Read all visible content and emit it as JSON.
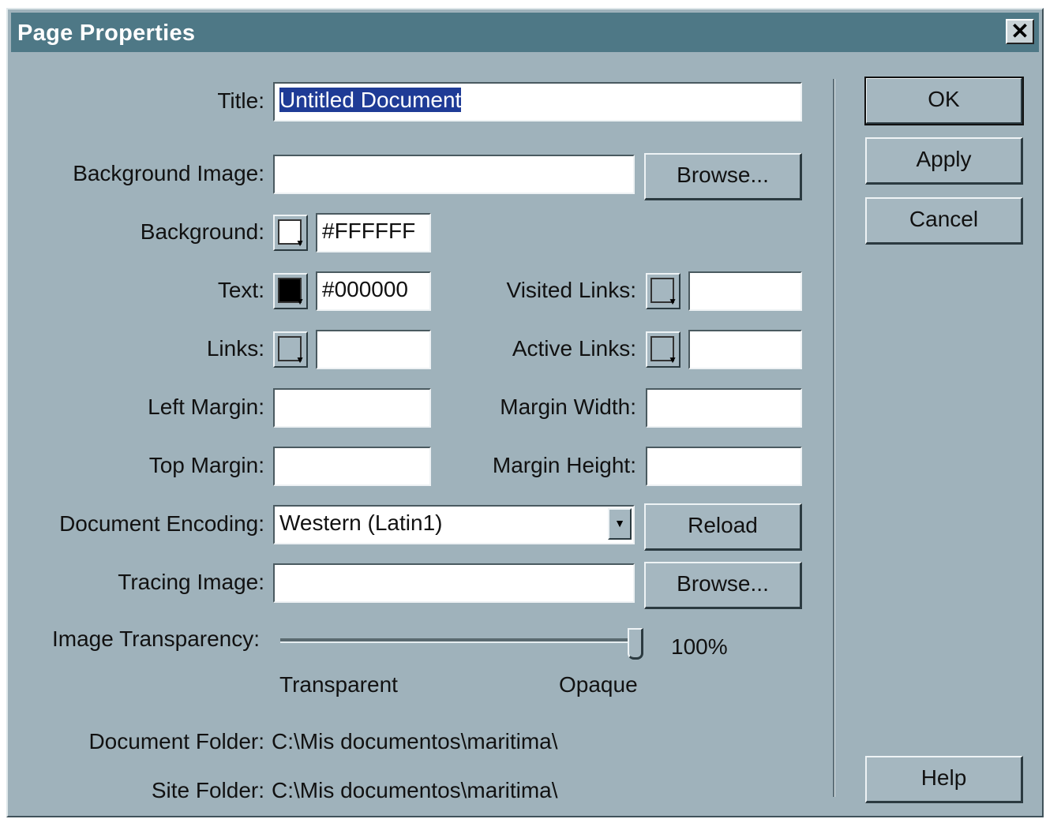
{
  "window": {
    "title": "Page Properties",
    "close_glyph": "✕"
  },
  "buttons": {
    "ok": "OK",
    "apply": "Apply",
    "cancel": "Cancel",
    "help": "Help",
    "browse_bg": "Browse...",
    "reload": "Reload",
    "browse_tracing": "Browse..."
  },
  "labels": {
    "title": "Title:",
    "background_image": "Background Image:",
    "background": "Background:",
    "text": "Text:",
    "links": "Links:",
    "visited_links": "Visited Links:",
    "active_links": "Active Links:",
    "left_margin": "Left Margin:",
    "margin_width": "Margin Width:",
    "top_margin": "Top Margin:",
    "margin_height": "Margin Height:",
    "document_encoding": "Document Encoding:",
    "tracing_image": "Tracing Image:",
    "image_transparency": "Image Transparency:",
    "transparent": "Transparent",
    "opaque": "Opaque",
    "document_folder": "Document Folder:",
    "site_folder": "Site Folder:"
  },
  "values": {
    "title": "Untitled Document",
    "background_image": "",
    "background_color": "#FFFFFF",
    "text_color": "#000000",
    "links_color": "",
    "visited_links_color": "",
    "active_links_color": "",
    "left_margin": "",
    "margin_width": "",
    "top_margin": "",
    "margin_height": "",
    "document_encoding": "Western (Latin1)",
    "tracing_image": "",
    "image_transparency_percent": 100,
    "image_transparency_label": "100%",
    "document_folder": "C:\\Mis documentos\\maritima\\",
    "site_folder": "C:\\Mis documentos\\maritima\\"
  },
  "swatch_colors": {
    "background": "#ffffff",
    "text": "#000000",
    "empty": "#a5b7c0"
  },
  "colors": {
    "dialog_bg": "#9fb2bb",
    "titlebar": "#4e7886",
    "selection": "#1f3b96"
  }
}
